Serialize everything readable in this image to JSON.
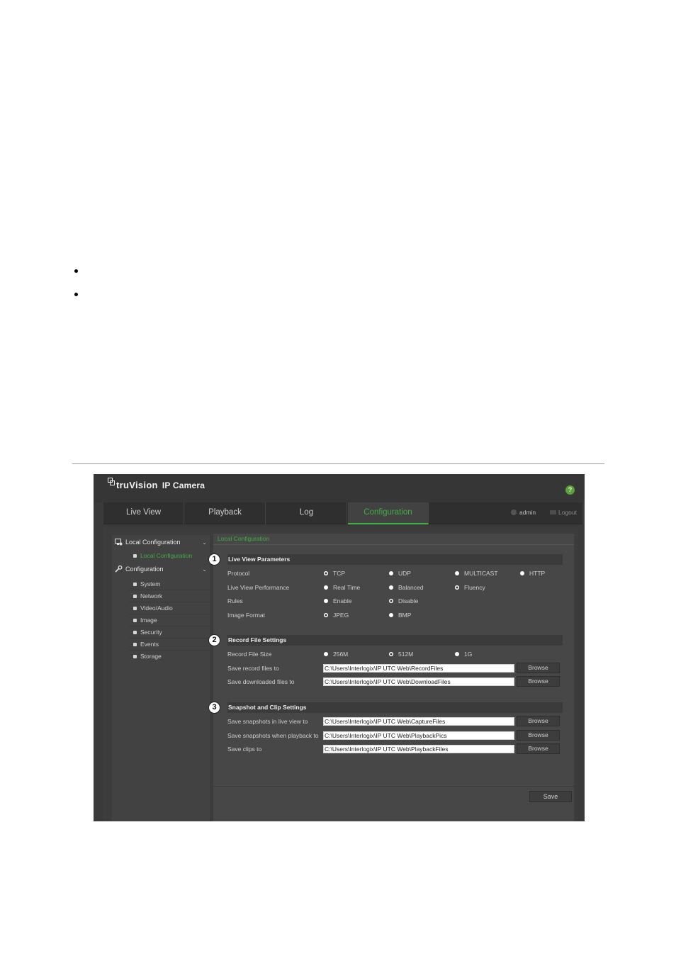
{
  "app": {
    "brand": "truVision",
    "product": "IP Camera",
    "help_glyph": "?"
  },
  "nav": {
    "tabs": [
      {
        "label": "Live View"
      },
      {
        "label": "Playback"
      },
      {
        "label": "Log"
      },
      {
        "label": "Configuration"
      }
    ],
    "active_tab": "Configuration",
    "user": "admin",
    "logout": "Logout"
  },
  "sidebar": {
    "local_header": "Local Configuration",
    "local_items": [
      "Local Configuration"
    ],
    "config_header": "Configuration",
    "config_items": [
      "System",
      "Network",
      "Video/Audio",
      "Image",
      "Security",
      "Events",
      "Storage"
    ]
  },
  "main": {
    "breadcrumb": "Local Configuration",
    "callouts": [
      "1",
      "2",
      "3"
    ],
    "live_view": {
      "title": "Live View Parameters",
      "protocol_label": "Protocol",
      "protocol_options": [
        "TCP",
        "UDP",
        "MULTICAST",
        "HTTP"
      ],
      "protocol_selected": "TCP",
      "performance_label": "Live View Performance",
      "performance_options": [
        "Real Time",
        "Balanced",
        "Fluency"
      ],
      "performance_selected": "Fluency",
      "rules_label": "Rules",
      "rules_options": [
        "Enable",
        "Disable"
      ],
      "rules_selected": "Disable",
      "image_format_label": "Image Format",
      "image_format_options": [
        "JPEG",
        "BMP"
      ],
      "image_format_selected": "JPEG"
    },
    "record": {
      "title": "Record File Settings",
      "size_label": "Record File Size",
      "size_options": [
        "256M",
        "512M",
        "1G"
      ],
      "size_selected": "512M",
      "record_path_label": "Save record files to",
      "record_path": "C:\\Users\\Interlogix\\IP UTC Web\\RecordFiles",
      "download_path_label": "Save downloaded files to",
      "download_path": "C:\\Users\\Interlogix\\IP UTC Web\\DownloadFiles"
    },
    "snapshot": {
      "title": "Snapshot and Clip Settings",
      "live_label": "Save snapshots in live view to",
      "live_path": "C:\\Users\\Interlogix\\IP UTC Web\\CaptureFiles",
      "playback_label": "Save snapshots when playback to",
      "playback_path": "C:\\Users\\Interlogix\\IP UTC Web\\PlaybackPics",
      "clips_label": "Save clips to",
      "clips_path": "C:\\Users\\Interlogix\\IP UTC Web\\PlaybackFiles"
    },
    "browse_label": "Browse",
    "save_label": "Save"
  },
  "colors": {
    "accent": "#3fae45",
    "background": "#3a3a3a",
    "help": "#5aa33a"
  }
}
